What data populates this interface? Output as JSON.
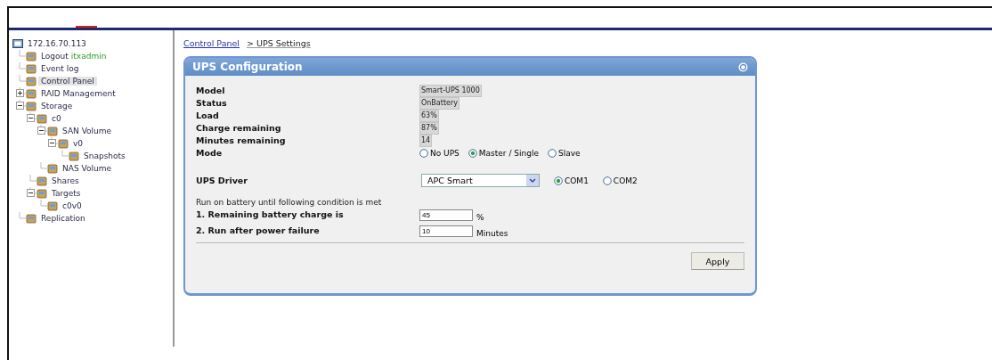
{
  "tree": {
    "host": "172.16.70.113",
    "items": [
      {
        "label": "Logout",
        "user": "itxadmin",
        "selected": false
      },
      {
        "label": "Event log",
        "selected": false
      },
      {
        "label": "Control Panel",
        "selected": true
      },
      {
        "label": "RAID Management",
        "selected": false,
        "expanded": false
      },
      {
        "label": "Storage",
        "selected": false,
        "expanded": true,
        "children": [
          {
            "label": "c0",
            "selected": false,
            "expanded": true,
            "children": [
              {
                "label": "SAN Volume",
                "selected": false,
                "expanded": true,
                "children": [
                  {
                    "label": "v0",
                    "selected": false,
                    "expanded": true,
                    "children": [
                      {
                        "label": "Snapshots",
                        "selected": false
                      }
                    ]
                  }
                ]
              },
              {
                "label": "NAS Volume",
                "selected": false
              }
            ]
          },
          {
            "label": "Shares",
            "selected": false
          },
          {
            "label": "Targets",
            "selected": false,
            "expanded": true,
            "children": [
              {
                "label": "c0v0",
                "selected": false
              }
            ]
          }
        ]
      },
      {
        "label": "Replication",
        "selected": false
      }
    ]
  },
  "breadcrumb": [
    {
      "label": "Control Panel",
      "kind": "link"
    },
    {
      "label": "> UPS Settings",
      "kind": "current"
    }
  ],
  "panel": {
    "title": "UPS Configuration",
    "info": [
      {
        "label": "Model",
        "value": "Smart-UPS 1000"
      },
      {
        "label": "Status",
        "value": "OnBattery"
      },
      {
        "label": "Load",
        "value": "63%"
      },
      {
        "label": "Charge remaining",
        "value": "87%"
      },
      {
        "label": "Minutes remaining",
        "value": "14"
      }
    ],
    "mode": {
      "label": "Mode",
      "options": [
        {
          "label": "No UPS",
          "selected": false
        },
        {
          "label": "Master / Single",
          "selected": true
        },
        {
          "label": "Slave",
          "selected": false
        }
      ]
    },
    "driver": {
      "label": "UPS Driver",
      "value": "APC Smart",
      "ports": [
        {
          "label": "COM1",
          "selected": true
        },
        {
          "label": "COM2",
          "selected": false
        }
      ]
    },
    "note": "Run on battery until following condition is met",
    "conditions": [
      {
        "label": "1. Remaining battery charge is",
        "value": "45",
        "unit": "%"
      },
      {
        "label": "2. Run after power failure",
        "value": "10",
        "unit": "Minutes"
      }
    ],
    "apply": "Apply"
  }
}
